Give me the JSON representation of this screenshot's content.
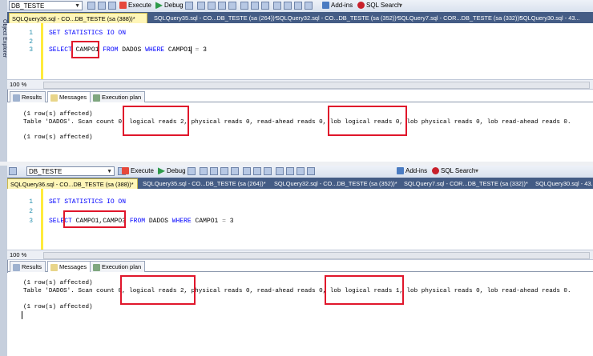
{
  "top": {
    "database": "DB_TESTE",
    "toolbar": {
      "execute": "Execute",
      "debug": "Debug",
      "addins": "Add-ins",
      "sql_search": "SQL Search"
    },
    "side_label": "Object Explorer",
    "tabs": [
      "SQLQuery36.sql - CO...DB_TESTE (sa (388))*",
      "SQLQuery35.sql - CO...DB_TESTE (sa (264))*",
      "SQLQuery32.sql - CO...DB_TESTE (sa (352))*",
      "SQLQuery7.sql - COR...DB_TESTE (sa (332))*",
      "SQLQuery30.sql - 43..."
    ],
    "line_numbers": [
      "1",
      "2",
      "3"
    ],
    "code": {
      "line1_kw": "SET STATISTICS IO ON",
      "l3_select": "SELECT",
      "l3_cols": "CAMPO1",
      "l3_from": "FROM",
      "l3_table": "DADOS",
      "l3_where": "WHERE",
      "l3_cond": "CAMPO1",
      "l3_eq": "=",
      "l3_val": "3"
    },
    "zoom": "100 %",
    "result_tabs": {
      "results": "Results",
      "messages": "Messages",
      "execution_plan": "Execution plan"
    },
    "messages": {
      "line1": "(1 row(s) affected)",
      "line2": "Table 'DADOS'. Scan count 0, logical reads 2, physical reads 0, read-ahead reads 0, lob logical reads 0, lob physical reads 0, lob read-ahead reads 0.",
      "line3": "(1 row(s) affected)"
    }
  },
  "bottom": {
    "database": "DB_TESTE",
    "toolbar": {
      "execute": "Execute",
      "debug": "Debug",
      "addins": "Add-ins",
      "sql_search": "SQL Search"
    },
    "tabs": [
      "SQLQuery36.sql - CO...DB_TESTE (sa (388))*",
      "SQLQuery35.sql - CO...DB_TESTE (sa (264))*",
      "SQLQuery32.sql - CO...DB_TESTE (sa (352))*",
      "SQLQuery7.sql - COR...DB_TESTE (sa (332))*",
      "SQLQuery30.sql - 43..."
    ],
    "line_numbers": [
      "1",
      "2",
      "3"
    ],
    "code": {
      "line1_kw": "SET STATISTICS IO ON",
      "l3_select": "SELECT",
      "l3_cols": "CAMPO1,CAMPO3",
      "l3_from": "FROM",
      "l3_table": "DADOS",
      "l3_where": "WHERE",
      "l3_cond": "CAMPO1",
      "l3_eq": "=",
      "l3_val": "3"
    },
    "zoom": "100 %",
    "result_tabs": {
      "results": "Results",
      "messages": "Messages",
      "execution_plan": "Execution plan"
    },
    "messages": {
      "line1": "(1 row(s) affected)",
      "line2": "Table 'DADOS'. Scan count 0, logical reads 2, physical reads 0, read-ahead reads 0, lob logical reads 1, lob physical reads 0, lob read-ahead reads 0.",
      "line3": "(1 row(s) affected)"
    }
  },
  "colors": {
    "highlight_box": "#e0162b",
    "keyword": "#0000ff",
    "line_number": "#2b91af",
    "active_tab": "#fff6b8",
    "tab_strip": "#445c85"
  }
}
